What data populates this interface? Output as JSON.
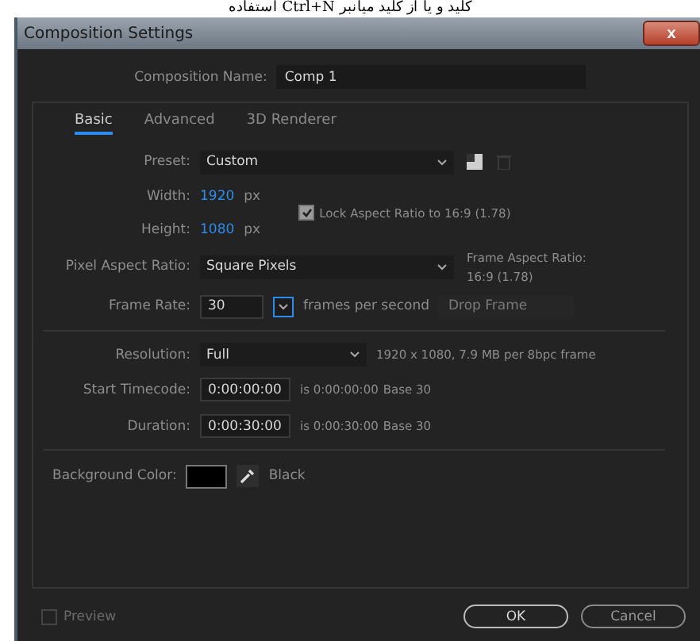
{
  "page_text": "کلید و یا از کلید میانبر Ctrl+N استفاده",
  "window": {
    "title": "Composition Settings",
    "close": "x"
  },
  "composition_name": {
    "label": "Composition Name:",
    "value": "Comp 1"
  },
  "tabs": [
    {
      "label": "Basic",
      "selected": true
    },
    {
      "label": "Advanced",
      "selected": false
    },
    {
      "label": "3D Renderer",
      "selected": false
    }
  ],
  "preset": {
    "label": "Preset:",
    "value": "Custom"
  },
  "width": {
    "label": "Width:",
    "value": "1920",
    "unit": "px"
  },
  "height": {
    "label": "Height:",
    "value": "1080",
    "unit": "px"
  },
  "lock_aspect": {
    "label": "Lock Aspect Ratio to 16:9 (1.78)",
    "checked": true
  },
  "pixel_aspect": {
    "label": "Pixel Aspect Ratio:",
    "value": "Square Pixels"
  },
  "frame_aspect": {
    "label": "Frame Aspect Ratio:",
    "value": "16:9 (1.78)"
  },
  "frame_rate": {
    "label": "Frame Rate:",
    "value": "30",
    "unit": "frames per second",
    "drop_frame": {
      "label": "Drop Frame",
      "disabled": true
    }
  },
  "resolution": {
    "label": "Resolution:",
    "value": "Full",
    "info": "1920 x 1080, 7.9 MB per 8bpc frame"
  },
  "timecodes": [
    {
      "label": "Start Timecode:",
      "value": "0:00:00:00",
      "info": "is 0:00:00:00",
      "base": "Base 30"
    },
    {
      "label": "Duration:",
      "value": "0:00:30:00",
      "info": "is 0:00:30:00",
      "base": "Base 30"
    }
  ],
  "background": {
    "label": "Background Color:",
    "color": "#000000",
    "name": "Black"
  },
  "preview": {
    "label": "Preview",
    "checked": false,
    "disabled": true
  },
  "buttons": [
    {
      "label": "OK",
      "kind": "primary"
    },
    {
      "label": "Cancel",
      "kind": "secondary"
    }
  ]
}
